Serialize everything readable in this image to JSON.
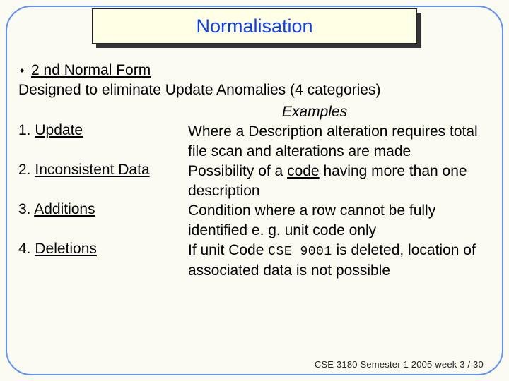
{
  "title": "Normalisation",
  "bullet_item": "2 nd Normal Form",
  "intro": "Designed to eliminate Update Anomalies (4 categories)",
  "examples_heading": "Examples",
  "rows": [
    {
      "num": "1.",
      "name": "Update",
      "desc_pre": "Where a Description alteration requires total file scan and alterations are made",
      "ul": ""
    },
    {
      "num": "2.",
      "name": "Inconsistent Data",
      "desc_pre": "Possibility of a ",
      "ul": "code",
      "desc_post": " having more than one description"
    },
    {
      "num": "3.",
      "name": "Additions",
      "desc_pre": "Condition where a row cannot be fully identified  e. g.  unit code only",
      "ul": ""
    },
    {
      "num": "4.",
      "name": "Deletions",
      "desc_pre": "If unit Code ",
      "mono": "CSE 9001",
      "desc_post": " is deleted, location of associated data is not possible"
    }
  ],
  "footer": "CSE 3180 Semester 1 2005  week 3 / 30"
}
